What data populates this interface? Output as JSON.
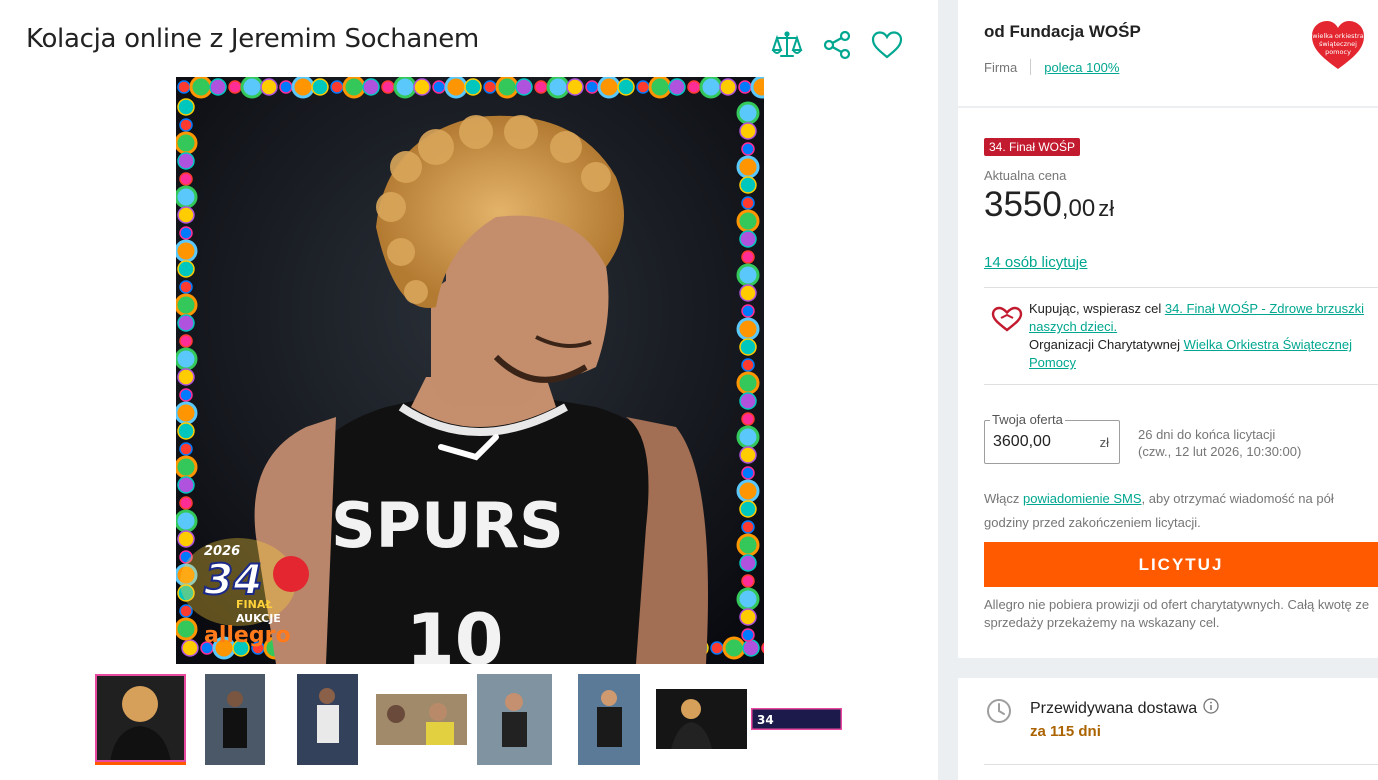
{
  "listing": {
    "title": "Kolacja online z Jeremim Sochanem",
    "image_frame": {
      "badge_number": "34",
      "badge_year": "2026",
      "badge_line1": "FINAŁ",
      "badge_line2": "AUKCJE",
      "brand": "allegro",
      "jersey_text": "SPURS",
      "jersey_number": "10"
    },
    "thumbnail_count": 8,
    "selected_thumbnail": 1
  },
  "header_actions": [
    {
      "name": "compare-icon",
      "icon": "scales"
    },
    {
      "name": "share-icon",
      "icon": "share"
    },
    {
      "name": "favorite-icon",
      "icon": "heart-outline"
    }
  ],
  "seller": {
    "name": "od Fundacja WOŚP",
    "type": "Firma",
    "rating": "poleca 100%",
    "logo_text": [
      "wielka orkiestra",
      "świątecznej",
      "pomocy"
    ]
  },
  "auction": {
    "badge": "34. Finał WOŚP",
    "price_label": "Aktualna cena",
    "price_int": "3550",
    "price_dec": ",00",
    "currency": "zł",
    "bidders": "14 osób licytuje",
    "charity_prefix": "Kupując, wspierasz cel ",
    "charity_goal": "34. Finał WOŚP - Zdrowe brzuszki naszych dzieci.",
    "charity_org_prefix": "Organizacji Charytatywnej ",
    "charity_org": "Wielka Orkiestra Świątecznej Pomocy",
    "offer_legend": "Twoja oferta",
    "offer_value": "3600,00",
    "offer_currency": "zł",
    "ends_in": "26 dni do końca licytacji",
    "ends_date": "(czw., 12 lut 2026, 10:30:00)",
    "sms_prefix": "Włącz ",
    "sms_link": "powiadomienie SMS",
    "sms_suffix": ", aby otrzymać wiadomość na pół godziny przed zakończeniem licytacji.",
    "bid_button": "LICYTUJ",
    "fee_note": "Allegro nie pobiera prowizji od ofert charytatywnych. Całą kwotę ze sprzedaży przekażemy na wskazany cel."
  },
  "delivery": {
    "label": "Przewidywana dostawa",
    "value": "za 115 dni"
  },
  "colors": {
    "accent": "#00a790",
    "primary_button": "#ff5a00",
    "badge": "#c21a2e",
    "delivery": "#ab6401"
  }
}
